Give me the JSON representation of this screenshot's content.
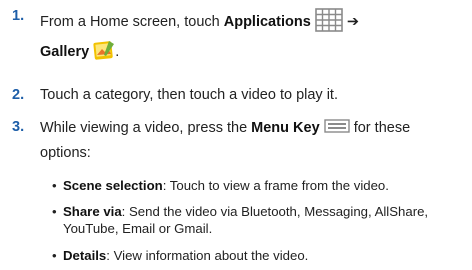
{
  "steps": [
    {
      "number": "1.",
      "line1_pre": "From a Home screen, touch ",
      "line1_bold": "Applications",
      "arrow": "➔",
      "line2_bold": "Gallery",
      "line2_post": "."
    },
    {
      "number": "2.",
      "text": "Touch a category, then touch a video to play it."
    },
    {
      "number": "3.",
      "pre": "While viewing a video, press the ",
      "bold": "Menu Key",
      "post": " for these",
      "line2": "options:"
    }
  ],
  "bullets": [
    {
      "bold": "Scene selection",
      "text": ": Touch to view a frame from the video."
    },
    {
      "bold": "Share via",
      "text": ": Send the video via Bluetooth, Messaging, AllShare, YouTube, Email or Gmail."
    },
    {
      "bold": "Details",
      "text": ": View information about the video."
    }
  ],
  "bullet_glyph": "•",
  "icons": {
    "applications": "applications-grid-icon",
    "gallery": "gallery-icon",
    "menu_key": "menu-key-icon"
  },
  "colors": {
    "step_number": "#1d5ea8",
    "text": "#222222",
    "icon_gray": "#8a8a8a",
    "gallery_yellow": "#f2c200",
    "gallery_orange": "#e8752a"
  }
}
